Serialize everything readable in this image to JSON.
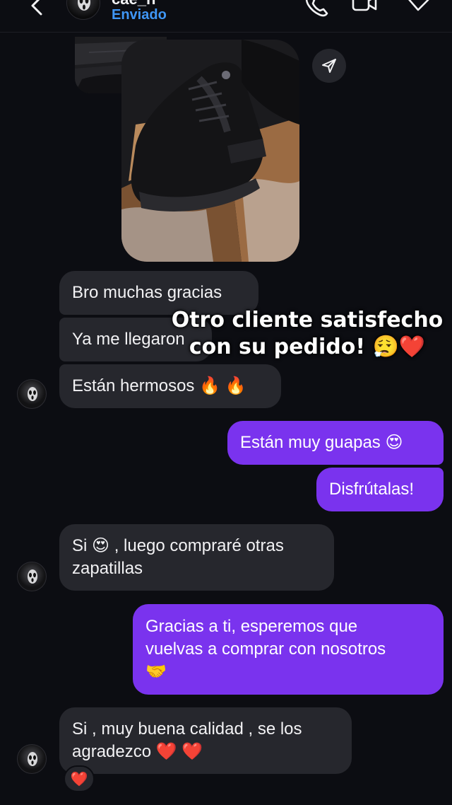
{
  "header": {
    "username": "cae_ñ",
    "status": "Enviado",
    "icons": [
      "back-icon",
      "phone-icon",
      "video-camera-icon",
      "tag-icon"
    ]
  },
  "shared_image": {
    "description_icon": "sneaker-photo",
    "share_icon": "send-icon"
  },
  "messages": [
    {
      "from": "other",
      "text": "Bro muchas gracias"
    },
    {
      "from": "other",
      "text": "Ya me llegaron"
    },
    {
      "from": "other",
      "text": "Están hermosos 🔥 🔥"
    },
    {
      "from": "me",
      "text": "Están muy guapas 😍"
    },
    {
      "from": "me",
      "text": "Disfrútalas!"
    },
    {
      "from": "other",
      "line1": "Si 😍 , luego compraré otras",
      "line2": "zapatillas"
    },
    {
      "from": "me",
      "line1": "Gracias a ti, esperemos que",
      "line2": "vuelvas a comprar con nosotros",
      "line3": "🤝"
    },
    {
      "from": "other",
      "line1": "Si , muy buena calidad , se los",
      "line2": "agradezco ❤️ ❤️"
    }
  ],
  "reaction": "❤️",
  "overlay": {
    "line1": "Otro cliente satisfecho",
    "line2": "con su pedido! 😮‍💨❤️"
  },
  "colors": {
    "background": "#0c0d12",
    "received_bubble": "#26272d",
    "sent_bubble": "#7a33ee",
    "status": "#3f96f5"
  }
}
